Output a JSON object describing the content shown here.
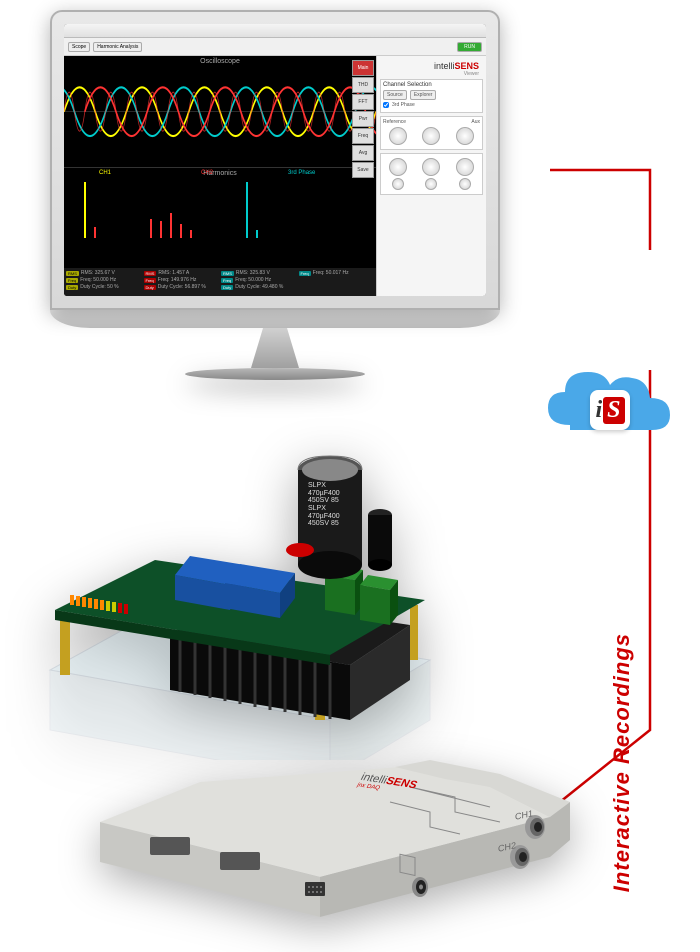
{
  "software": {
    "brand_prefix": "intelli",
    "brand_suffix": "SENS",
    "brand_subtitle": "Viewer",
    "toolbar": {
      "tab1": "Scope",
      "tab2": "Harmonic Analysis"
    },
    "scope_title": "Oscilloscope",
    "harmonics_title": "Harmonics",
    "channels": {
      "ch1": "CH1",
      "ch2": "CH2",
      "ch3": "3rd Phase"
    },
    "side_tabs": [
      "Main",
      "THD",
      "FFT",
      "Pwr",
      "Freq",
      "Avg",
      "Save"
    ],
    "panel_channel_title": "Channel Selection",
    "panel_buttons": [
      "Source",
      "Explorer"
    ],
    "panel_explorer_sub": "3rd Phase",
    "horiz_labels": [
      "Reference",
      "Aux"
    ],
    "run_label": "RUN",
    "measurements": [
      {
        "tag": "RMS",
        "ch": "y",
        "label": "RMS: 325.67 V"
      },
      {
        "tag": "Freq",
        "ch": "y",
        "label": "Freq: 50.000 Hz"
      },
      {
        "tag": "Duty",
        "ch": "y",
        "label": "Duty Cycle: 50 %"
      },
      {
        "tag": "RMS",
        "ch": "r",
        "label": "RMS: 1.457 A"
      },
      {
        "tag": "Freq",
        "ch": "r",
        "label": "Freq: 149.976 Hz"
      },
      {
        "tag": "Duty",
        "ch": "r",
        "label": "Duty Cycle: 56.897 %"
      },
      {
        "tag": "RMS",
        "ch": "c",
        "label": "RMS: 325.83 V"
      },
      {
        "tag": "Freq",
        "ch": "c",
        "label": "Freq: 50.000 Hz"
      },
      {
        "tag": "Duty",
        "ch": "c",
        "label": "Duty Cycle: 49.480 %"
      },
      {
        "tag": "Freq",
        "ch": "c",
        "label": "Freq: 50.017 Hz"
      }
    ]
  },
  "cloud": {
    "badge_i": "i",
    "badge_s": "S"
  },
  "vertical_label": "Interactive Recordings",
  "capacitor": {
    "line1": "SLPX",
    "line2": "470µF400",
    "line3": "450SV 85",
    "line4": "SLPX",
    "line5": "470µF400",
    "line6": "450SV 85"
  },
  "daq": {
    "brand_prefix": "intelli",
    "brand_suffix": "SENS",
    "brand_subtitle": "jnx DAQ",
    "ch1": "CH1",
    "ch2": "CH2"
  }
}
